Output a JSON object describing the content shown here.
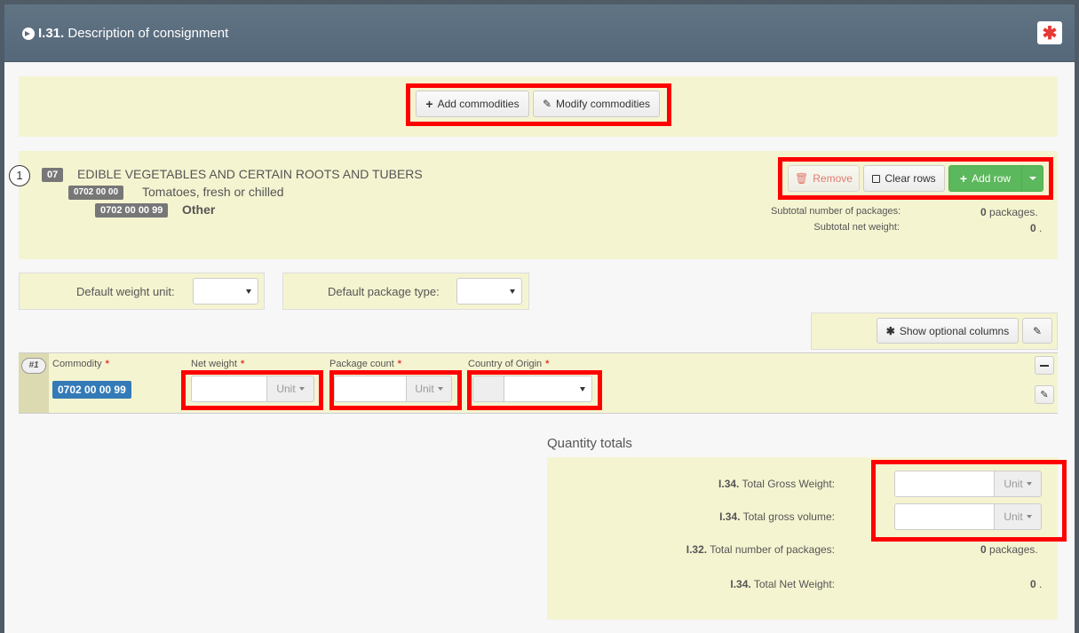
{
  "header": {
    "number": "I.31.",
    "title": "Description of consignment",
    "required_symbol": "✱"
  },
  "commodity_actions": {
    "add_label": "Add commodities",
    "modify_label": "Modify commodities"
  },
  "classification": {
    "index": "1",
    "chapter_code": "07",
    "chapter_name": "EDIBLE VEGETABLES AND CERTAIN ROOTS AND TUBERS",
    "heading_code": "0702 00 00",
    "heading_name": "Tomatoes, fresh or chilled",
    "sub_code": "0702 00 00 99",
    "sub_name": "Other"
  },
  "row_actions": {
    "remove_label": "Remove",
    "clear_label": "Clear rows",
    "add_row_label": "Add row"
  },
  "subtotals": {
    "packages_label": "Subtotal number of packages:",
    "packages_value": "0",
    "packages_unit": "packages.",
    "weight_label": "Subtotal net weight:",
    "weight_value": "0",
    "weight_unit": "."
  },
  "defaults": {
    "weight_unit_label": "Default weight unit:",
    "package_type_label": "Default package type:"
  },
  "optional_columns": {
    "label": "Show optional columns"
  },
  "commodity_row": {
    "row_number": "#1",
    "commodity_header": "Commodity",
    "commodity_value": "0702 00 00 99",
    "net_weight_header": "Net weight",
    "package_count_header": "Package count",
    "country_header": "Country of Origin",
    "unit_label": "Unit",
    "required_mark": "*"
  },
  "totals": {
    "section_title": "Quantity totals",
    "gross_weight_code": "I.34.",
    "gross_weight_label": "Total Gross Weight:",
    "gross_volume_code": "I.34.",
    "gross_volume_label": "Total gross volume:",
    "packages_code": "I.32.",
    "packages_label": "Total number of packages:",
    "packages_value": "0",
    "packages_unit": "packages.",
    "net_weight_code": "I.34.",
    "net_weight_label": "Total Net Weight:",
    "net_weight_value": "0",
    "net_weight_unit": ".",
    "unit_label": "Unit"
  },
  "colors": {
    "header_bg": "#5b6d7e",
    "panel_bg": "#f5f4d1",
    "add_row_green": "#5cb85c",
    "highlight_red": "#ff0000",
    "commodity_badge": "#337ab7"
  }
}
